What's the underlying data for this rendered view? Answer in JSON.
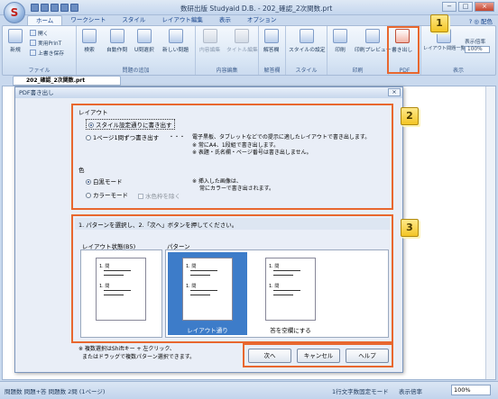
{
  "window": {
    "title": "数研出版 Studyaid D.B. - 202_確認_2次関数.prt",
    "controls": [
      "−",
      "□",
      "×"
    ]
  },
  "app": {
    "orb_letter": "S"
  },
  "ribbon_tabs": [
    {
      "label": "ホーム",
      "active": true
    },
    {
      "label": "ワークシート",
      "active": false
    },
    {
      "label": "スタイル",
      "active": false
    },
    {
      "label": "レイアウト編集",
      "active": false
    },
    {
      "label": "表示",
      "active": false
    },
    {
      "label": "オプション",
      "active": false
    }
  ],
  "helpbar": {
    "text": "? ◎ 配色"
  },
  "ribbon": {
    "file": {
      "label": "ファイル",
      "new": "新規",
      "open": "開く",
      "print_t": "実用PrinT",
      "save_as": "上書き保存"
    },
    "add_problem": {
      "label": "問題の追加",
      "search": "検索",
      "auto_create": "自動作問",
      "u_select": "U問選択",
      "new_problem": "新しい問題"
    },
    "content_edit": {
      "label": "内容編集",
      "content_edit": "内容編集",
      "title_edit": "タイトル編集"
    },
    "answer_sheet": {
      "label": "解答欄",
      "btn": "解答欄"
    },
    "style": {
      "label": "スタイル",
      "btn": "スタイルの設定"
    },
    "print": {
      "label": "印刷",
      "print": "印刷",
      "preview": "印刷プレビュー"
    },
    "pdf": {
      "label": "PDF",
      "btn": "書き出し"
    },
    "view": {
      "label": "表示",
      "layout_list": "レイアウト問題一覧",
      "zoom_label": "表示倍率",
      "zoom_value": "100%"
    }
  },
  "callouts": [
    "1",
    "2",
    "3"
  ],
  "document_tab": "202_確認_2次関数.prt",
  "dialog": {
    "title": "PDF書き出し",
    "layout_section": {
      "heading": "レイアウト",
      "option1": "スタイル設定通りに書き出す",
      "option2": "1ページ1問ずつ書き出す",
      "dots": "・・・",
      "note1": "電子黒板、タブレットなどでの提示に適したレイアウトで書き出します。",
      "note2": "※ 常にA4、1段組で書き出します。",
      "note3": "※ 表題・氏名欄・ページ番号は書き出しません。"
    },
    "color_section": {
      "heading": "色",
      "mono": "白黒モード",
      "color": "カラーモード",
      "exclude_water": "水色枠を除く",
      "note1": "※ 挿入した画像は、",
      "note2": "常にカラーで書き出されます。"
    },
    "pattern_section": {
      "instruction": "1. パターンを選択し、2.「次へ」ボタンを押してください。",
      "layout_state_label": "レイアウト状態(B5)",
      "pattern_label": "パターン",
      "patterns": [
        {
          "name": "レイアウト通り",
          "selected": true
        },
        {
          "name": "答を空欄にする",
          "selected": false
        }
      ],
      "card_text": "1. 問"
    },
    "hint_line1": "※ 複数選択はShiftキー + 左クリック、",
    "hint_line2": "またはドラッグで複数パターン選択できます。",
    "buttons": {
      "next": "次へ",
      "cancel": "キャンセル",
      "help": "ヘルプ"
    }
  },
  "statusbar": {
    "left": "問題数 問題+答 問題数 2問 (1ページ)",
    "mode": "1行文字数固定モード",
    "zoom_label": "表示倍率",
    "zoom_value": "100%"
  },
  "colors": {
    "highlight": "#e8672e",
    "callout": "#f3c524",
    "selected_pattern": "#3d7cc9"
  }
}
